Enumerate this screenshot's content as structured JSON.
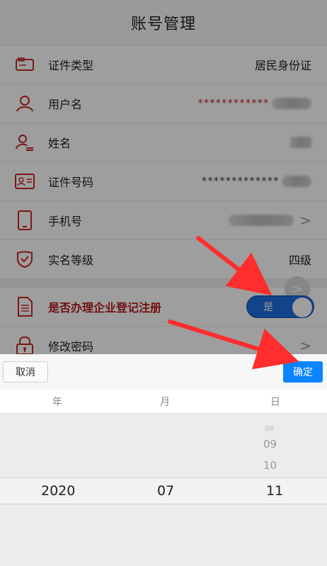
{
  "header": {
    "title": "账号管理"
  },
  "rows": [
    {
      "label": "证件类型",
      "value": "居民身份证"
    },
    {
      "label": "用户名",
      "masked": "************"
    },
    {
      "label": "姓名"
    },
    {
      "label": "证件号码",
      "masked": "*************"
    },
    {
      "label": "手机号",
      "chevron": ">"
    },
    {
      "label": "实名等级",
      "value": "四级"
    }
  ],
  "register_row": {
    "label": "是否办理企业登记注册",
    "toggle_label": "是",
    "ghost_chevron": ">"
  },
  "password_row": {
    "label": "修改密码",
    "chevron": ">"
  },
  "picker": {
    "cancel_label": "取消",
    "confirm_label": "确定",
    "columns": [
      "年",
      "月",
      "日"
    ],
    "day_above": [
      "08",
      "09",
      "10"
    ],
    "selected": {
      "year": "2020",
      "month": "07",
      "day": "11"
    }
  },
  "colors": {
    "accent_blue": "#0a84ff",
    "toggle_blue": "#1f6fe0",
    "highlight_red": "#b71c1c",
    "arrow_red": "#ff2d2d"
  },
  "icons": [
    "id-card-icon",
    "user-icon",
    "user-lines-icon",
    "id-number-icon",
    "phone-icon",
    "shield-check-icon",
    "document-icon",
    "lock-icon"
  ]
}
